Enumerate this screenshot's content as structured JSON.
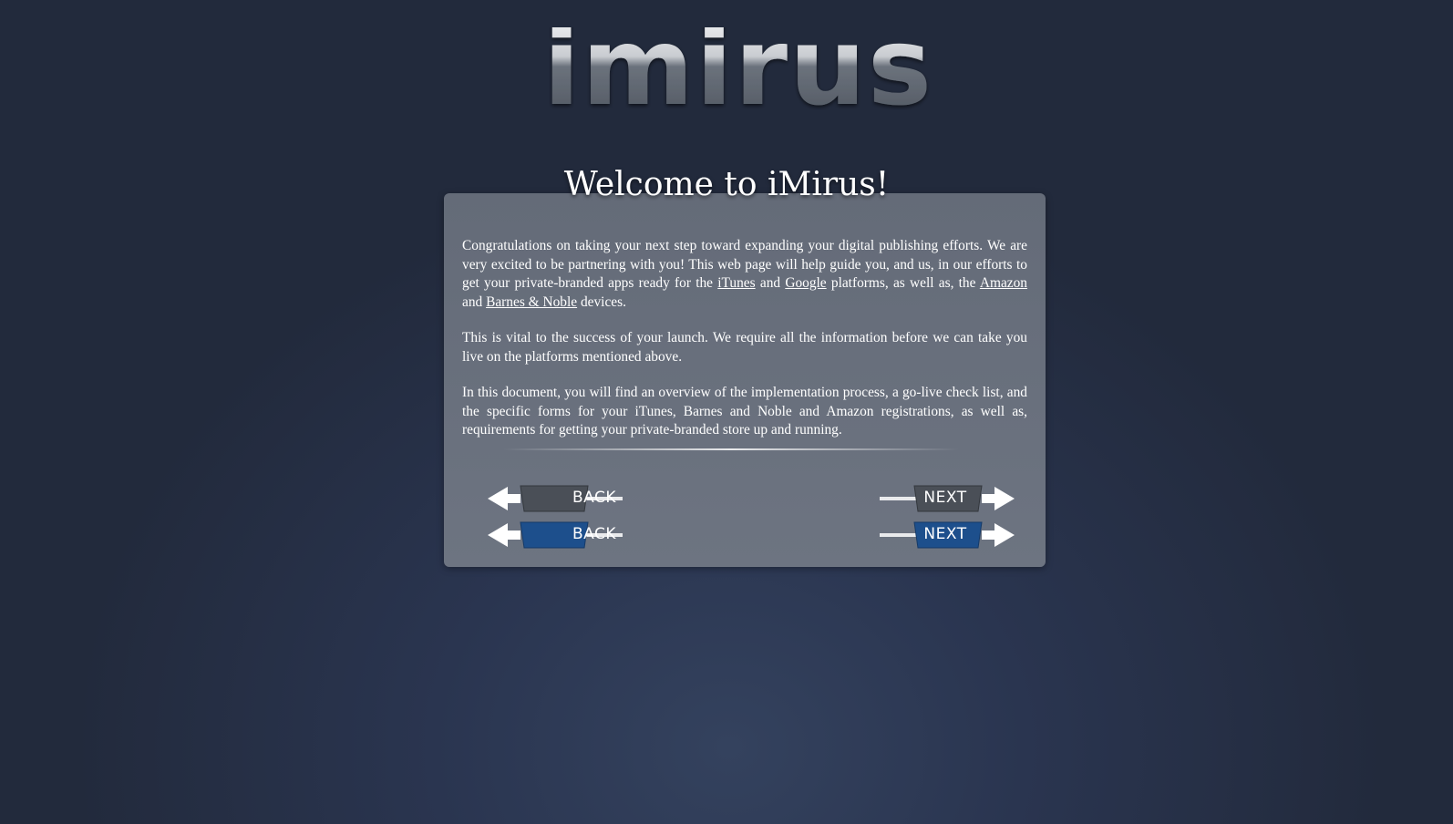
{
  "brand": {
    "logo_text": "imirus",
    "logo_icon": "imirus-logo"
  },
  "welcome": {
    "title": "Welcome to iMirus!"
  },
  "intro": {
    "p1_part1": "Congratulations on taking your next step toward expanding your digital publishing efforts. We are very excited to be partnering with you! This web page will help guide you, and us, in our efforts to get your private-branded apps ready for the ",
    "itunes_link": "iTunes",
    "and1": " and ",
    "google_link": "Google",
    "p1_part2": " platforms, as well as, the ",
    "amazon_link": "Amazon",
    "and2": " and ",
    "bn_link": "Barnes & Noble",
    "p1_part3": " devices.",
    "p2": "This is vital to the success of your launch. We require all the information before we can take you live on the platforms mentioned above.",
    "p3": "In this document, you will find an overview of the implementation process, a go-live check list, and the specific forms for your iTunes, Barnes and Noble and Amazon registrations, as well as, requirements for getting your private-branded store up and running."
  },
  "navigation": {
    "back_label": "BACK",
    "next_label": "NEXT",
    "back_icon": "arrow-left-icon",
    "next_icon": "arrow-right-icon"
  },
  "colors": {
    "page_background": "#222a3c",
    "panel": "#676e7b",
    "button_dark": "#4a4f57",
    "button_blue": "#1d4f8c"
  }
}
